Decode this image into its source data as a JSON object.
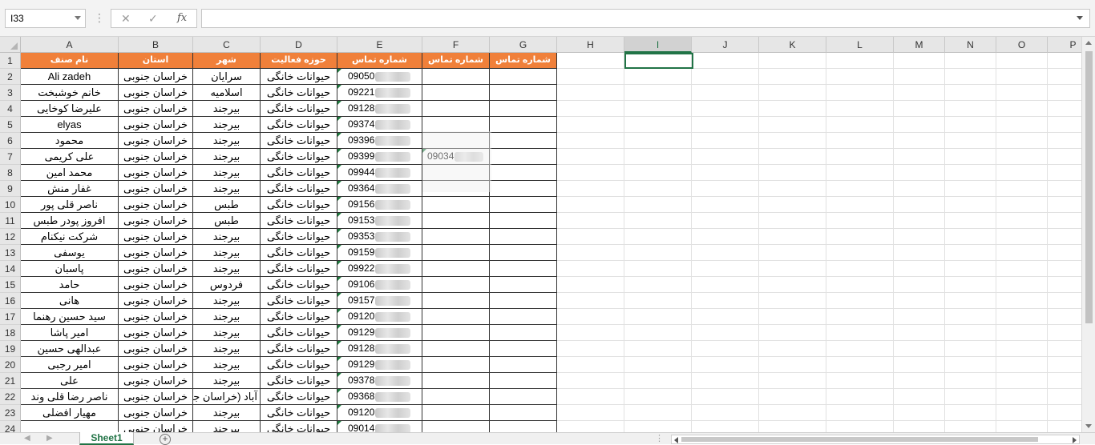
{
  "formula_bar": {
    "name_box": "I33",
    "cancel_icon": "✕",
    "enter_icon": "✓",
    "fx_label": "fx",
    "formula": ""
  },
  "columns": [
    "A",
    "B",
    "C",
    "D",
    "E",
    "F",
    "G",
    "H",
    "I",
    "J",
    "K",
    "L",
    "M",
    "N",
    "O",
    "P"
  ],
  "selected_column": "I",
  "row_numbers": [
    "1",
    "2",
    "3",
    "4",
    "5",
    "6",
    "7",
    "8",
    "9",
    "10",
    "11",
    "12",
    "13",
    "14",
    "15",
    "16",
    "17",
    "18",
    "19",
    "20",
    "21",
    "22",
    "23",
    "24"
  ],
  "headers": [
    "نام صنف",
    "استان",
    "شهر",
    "حوزه فعالیت",
    "شماره تماس",
    "شماره تماس",
    "شماره تماس"
  ],
  "rows": [
    {
      "name": "Ali zadeh",
      "province": "خراسان جنوبی",
      "city": "سرایان",
      "field": "حیوانات خانگی",
      "phone": "09050",
      "phone2": ""
    },
    {
      "name": "خانم خوشبخت",
      "province": "خراسان جنوبی",
      "city": "اسلامیه",
      "field": "حیوانات خانگی",
      "phone": "09221",
      "phone2": ""
    },
    {
      "name": "علیرضا کوخایی",
      "province": "خراسان جنوبی",
      "city": "بیرجند",
      "field": "حیوانات خانگی",
      "phone": "09128",
      "phone2": ""
    },
    {
      "name": "elyas",
      "province": "خراسان جنوبی",
      "city": "بیرجند",
      "field": "حیوانات خانگی",
      "phone": "09374",
      "phone2": ""
    },
    {
      "name": "محمود",
      "province": "خراسان جنوبی",
      "city": "بیرجند",
      "field": "حیوانات خانگی",
      "phone": "09396",
      "phone2": ""
    },
    {
      "name": "علی کریمی",
      "province": "خراسان جنوبی",
      "city": "بیرجند",
      "field": "حیوانات خانگی",
      "phone": "09399",
      "phone2": "09034"
    },
    {
      "name": "محمد امین",
      "province": "خراسان جنوبی",
      "city": "بیرجند",
      "field": "حیوانات خانگی",
      "phone": "09944",
      "phone2": ""
    },
    {
      "name": "غفار منش",
      "province": "خراسان جنوبی",
      "city": "بیرجند",
      "field": "حیوانات خانگی",
      "phone": "09364",
      "phone2": ""
    },
    {
      "name": "ناصر قلی پور",
      "province": "خراسان جنوبی",
      "city": "طبس",
      "field": "حیوانات خانگی",
      "phone": "09156",
      "phone2": ""
    },
    {
      "name": "افروز پودر طبس",
      "province": "خراسان جنوبی",
      "city": "طبس",
      "field": "حیوانات خانگی",
      "phone": "09153",
      "phone2": ""
    },
    {
      "name": "شرکت نیکنام",
      "province": "خراسان جنوبی",
      "city": "بیرجند",
      "field": "حیوانات خانگی",
      "phone": "09353",
      "phone2": ""
    },
    {
      "name": "یوسفی",
      "province": "خراسان جنوبی",
      "city": "بیرجند",
      "field": "حیوانات خانگی",
      "phone": "09159",
      "phone2": ""
    },
    {
      "name": "پاسبان",
      "province": "خراسان جنوبی",
      "city": "بیرجند",
      "field": "حیوانات خانگی",
      "phone": "09922",
      "phone2": ""
    },
    {
      "name": "حامد",
      "province": "خراسان جنوبی",
      "city": "فردوس",
      "field": "حیوانات خانگی",
      "phone": "09106",
      "phone2": ""
    },
    {
      "name": "هانی",
      "province": "خراسان جنوبی",
      "city": "بیرجند",
      "field": "حیوانات خانگی",
      "phone": "09157",
      "phone2": ""
    },
    {
      "name": "سید حسین رهنما",
      "province": "خراسان جنوبی",
      "city": "بیرجند",
      "field": "حیوانات خانگی",
      "phone": "09120",
      "phone2": ""
    },
    {
      "name": "امیر پاشا",
      "province": "خراسان جنوبی",
      "city": "بیرجند",
      "field": "حیوانات خانگی",
      "phone": "09129",
      "phone2": ""
    },
    {
      "name": "عبدالهی حسین",
      "province": "خراسان جنوبی",
      "city": "بیرجند",
      "field": "حیوانات خانگی",
      "phone": "09128",
      "phone2": ""
    },
    {
      "name": "امیر رجبی",
      "province": "خراسان جنوبی",
      "city": "بیرجند",
      "field": "حیوانات خانگی",
      "phone": "09129",
      "phone2": ""
    },
    {
      "name": "علی",
      "province": "خراسان جنوبی",
      "city": "بیرجند",
      "field": "حیوانات خانگی",
      "phone": "09378",
      "phone2": ""
    },
    {
      "name": "ناصر رضا قلی وند",
      "province": "خراسان جنوبی",
      "city": "آباد (خراسان جنوبی)",
      "field": "حیوانات خانگی",
      "phone": "09368",
      "phone2": ""
    },
    {
      "name": "مهیار افضلی",
      "province": "خراسان جنوبی",
      "city": "بیرجند",
      "field": "حیوانات خانگی",
      "phone": "09120",
      "phone2": ""
    },
    {
      "name": "",
      "province": "خراسان جنوبی",
      "city": "بیرجند",
      "field": "حیوانات خانگی",
      "phone": "09014",
      "phone2": ""
    }
  ],
  "sheet_tabs": [
    "Sheet1"
  ],
  "add_sheet_icon": "+",
  "accent_color": "#217346",
  "header_fill_color": "#f0803a"
}
